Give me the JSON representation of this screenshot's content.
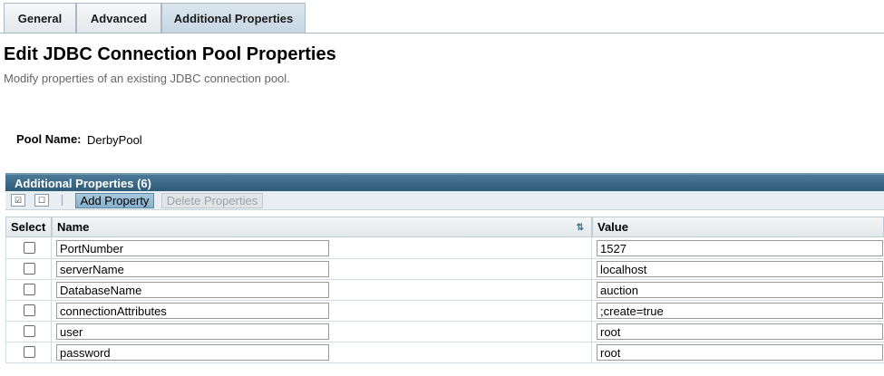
{
  "tabs": [
    {
      "label": "General"
    },
    {
      "label": "Advanced"
    },
    {
      "label": "Additional Properties"
    }
  ],
  "header": {
    "title": "Edit JDBC Connection Pool Properties",
    "subtitle": "Modify properties of an existing JDBC connection pool."
  },
  "pool": {
    "label": "Pool Name:",
    "value": "DerbyPool"
  },
  "table": {
    "title": "Additional Properties (6)",
    "add_label": "Add Property",
    "delete_label": "Delete Properties",
    "columns": {
      "select": "Select",
      "name": "Name",
      "value": "Value"
    },
    "rows": [
      {
        "name": "PortNumber",
        "value": "1527"
      },
      {
        "name": "serverName",
        "value": "localhost"
      },
      {
        "name": "DatabaseName",
        "value": "auction"
      },
      {
        "name": "connectionAttributes",
        "value": ";create=true"
      },
      {
        "name": "user",
        "value": "root"
      },
      {
        "name": "password",
        "value": "root"
      }
    ]
  },
  "icons": {
    "select_all": "select-all-icon",
    "deselect_all": "deselect-all-icon",
    "sort": "sort-icon"
  }
}
